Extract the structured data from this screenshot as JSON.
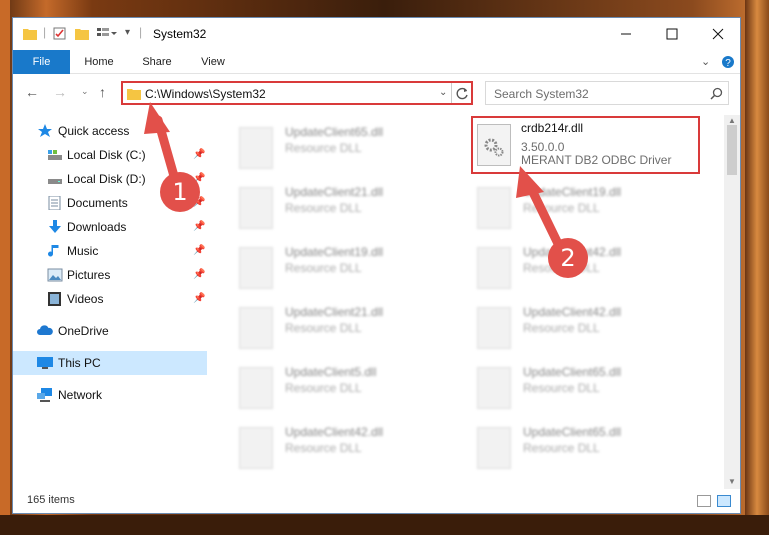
{
  "window": {
    "title": "System32",
    "accent": "#1979ca",
    "highlight": "#d93a3a"
  },
  "ribbon": {
    "tabs": [
      "File",
      "Home",
      "Share",
      "View"
    ]
  },
  "address": {
    "path": "C:\\Windows\\System32",
    "search_placeholder": "Search System32"
  },
  "sidebar": {
    "items": [
      {
        "label": "Quick access",
        "icon": "star-icon"
      },
      {
        "label": "Local Disk (C:)",
        "icon": "drive-icon"
      },
      {
        "label": "Local Disk (D:)",
        "icon": "drive-icon"
      },
      {
        "label": "Documents",
        "icon": "documents-icon"
      },
      {
        "label": "Downloads",
        "icon": "downloads-icon"
      },
      {
        "label": "Music",
        "icon": "music-icon"
      },
      {
        "label": "Pictures",
        "icon": "pictures-icon"
      },
      {
        "label": "Videos",
        "icon": "videos-icon"
      },
      {
        "label": "OneDrive",
        "icon": "cloud-icon"
      },
      {
        "label": "This PC",
        "icon": "computer-icon"
      },
      {
        "label": "Network",
        "icon": "network-icon"
      }
    ]
  },
  "files": {
    "left": [
      {
        "name": "UpdateClient65.dll",
        "desc": "Resource DLL"
      },
      {
        "name": "UpdateClient21.dll",
        "desc": "Resource DLL"
      },
      {
        "name": "UpdateClient19.dll",
        "desc": "Resource DLL"
      },
      {
        "name": "UpdateClient21.dll",
        "desc": "Resource DLL"
      },
      {
        "name": "UpdateClient5.dll",
        "desc": "Resource DLL"
      },
      {
        "name": "UpdateClient42.dll",
        "desc": "Resource DLL"
      }
    ],
    "right": [
      {
        "name": "crdb214r.dll",
        "desc": "3.50.0.0",
        "desc2": "MERANT DB2 ODBC Driver"
      },
      {
        "name": "UpdateClient19.dll",
        "desc": "Resource DLL"
      },
      {
        "name": "UpdateClient42.dll",
        "desc": "Resource DLL"
      },
      {
        "name": "UpdateClient42.dll",
        "desc": "Resource DLL"
      },
      {
        "name": "UpdateClient65.dll",
        "desc": "Resource DLL"
      },
      {
        "name": "UpdateClient65.dll",
        "desc": "Resource DLL"
      }
    ]
  },
  "status": {
    "count": "165 items"
  },
  "annotations": {
    "step1": "1",
    "step2": "2"
  }
}
